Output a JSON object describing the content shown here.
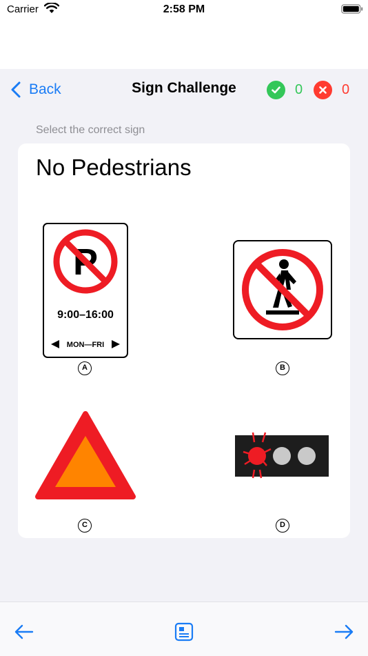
{
  "status_bar": {
    "carrier": "Carrier",
    "time": "2:58 PM"
  },
  "nav": {
    "back_label": "Back",
    "title": "Sign Challenge",
    "correct_count": "0",
    "wrong_count": "0"
  },
  "quiz": {
    "instruction": "Select the correct sign",
    "question": "No Pedestrians",
    "options": [
      {
        "label": "A",
        "sign_text_time": "9:00–16:00",
        "sign_text_days": "MON—FRI"
      },
      {
        "label": "B"
      },
      {
        "label": "C"
      },
      {
        "label": "D"
      }
    ]
  },
  "colors": {
    "accent": "#1a7cf5",
    "correct": "#34c759",
    "wrong": "#ff3b30",
    "sign_red": "#ee1c24",
    "sign_orange": "#ff8400"
  },
  "icons": {
    "toolbar": [
      "arrow-left-icon",
      "document-icon",
      "arrow-right-icon"
    ]
  }
}
